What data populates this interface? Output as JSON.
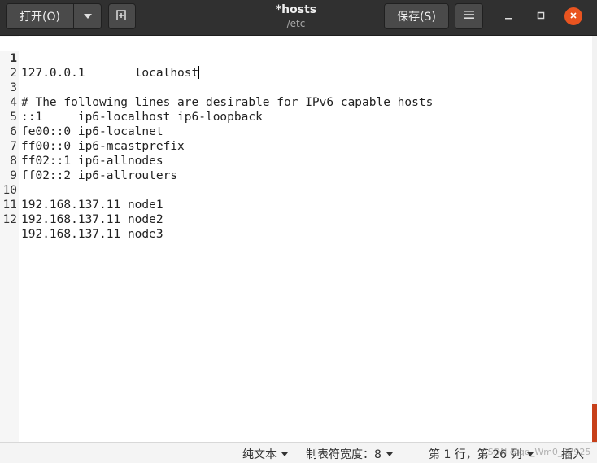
{
  "headerbar": {
    "open_label": "打开(O)",
    "save_label": "保存(S)",
    "title": "*hosts",
    "subtitle": "/etc"
  },
  "editor": {
    "current_line": 1,
    "lines": [
      {
        "num": "1",
        "text": "127.0.0.1       localhost"
      },
      {
        "num": "2",
        "text": ""
      },
      {
        "num": "3",
        "text": "# The following lines are desirable for IPv6 capable hosts"
      },
      {
        "num": "4",
        "text": "::1     ip6-localhost ip6-loopback"
      },
      {
        "num": "5",
        "text": "fe00::0 ip6-localnet"
      },
      {
        "num": "6",
        "text": "ff00::0 ip6-mcastprefix"
      },
      {
        "num": "7",
        "text": "ff02::1 ip6-allnodes"
      },
      {
        "num": "8",
        "text": "ff02::2 ip6-allrouters"
      },
      {
        "num": "9",
        "text": ""
      },
      {
        "num": "10",
        "text": "192.168.137.11 node1"
      },
      {
        "num": "11",
        "text": "192.168.137.11 node2"
      },
      {
        "num": "12",
        "text": "192.168.137.11 node3"
      }
    ]
  },
  "statusbar": {
    "language": "纯文本",
    "tab_width": "制表符宽度：8",
    "position": "第 1 行，第 26 列",
    "insert_mode": "插入"
  },
  "watermark": "CSDN @qq_Wm0_97925",
  "icons": {
    "open_menu": "chevron-down-icon",
    "new_tab": "new-document-icon",
    "hamburger": "hamburger-menu-icon",
    "minimize": "minimize-icon",
    "maximize": "maximize-icon",
    "close": "close-icon"
  },
  "colors": {
    "headerbar": "#303030",
    "close_button": "#e95420",
    "scroll_thumb": "#c7401a"
  }
}
